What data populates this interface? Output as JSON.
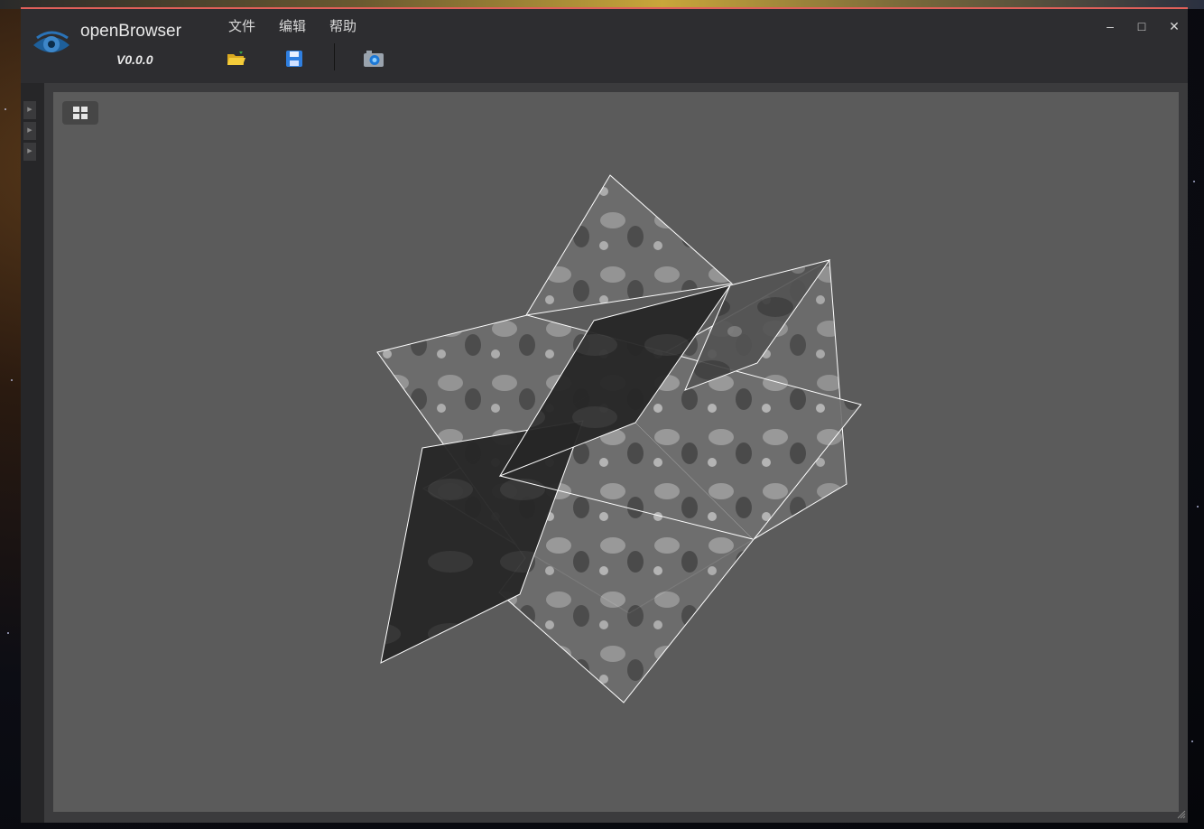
{
  "app": {
    "name": "openBrowser",
    "version": "V0.0.0"
  },
  "menu": {
    "items": [
      "文件",
      "编辑",
      "帮助"
    ]
  },
  "toolbar": {
    "open_icon": "folder-open-icon",
    "save_icon": "save-icon",
    "screenshot_icon": "camera-icon"
  },
  "window_controls": {
    "minimize": "–",
    "maximize": "□",
    "close": "✕"
  },
  "viewport": {
    "layout_icon": "grid-layout-icon",
    "content": "3D orthogonal CT slice planes (axial, sagittal, coronal)"
  },
  "colors": {
    "accent_border": "#e0605a",
    "window_bg": "#2d2d30",
    "viewport_bg": "#5b5b5b"
  }
}
